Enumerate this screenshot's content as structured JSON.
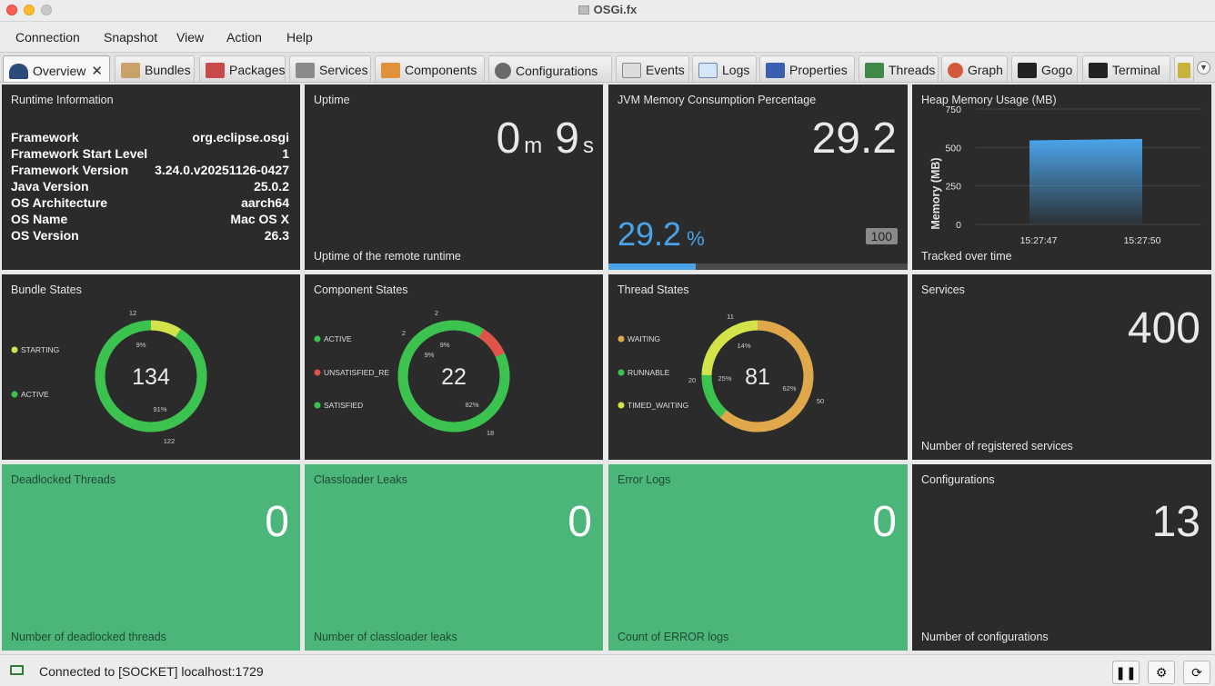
{
  "window": {
    "title": "OSGi.fx"
  },
  "menu": [
    "Connection",
    "Snapshot",
    "View",
    "Action",
    "Help"
  ],
  "tabs": [
    "Overview",
    "Bundles",
    "Packages",
    "Services",
    "Components",
    "Configurations",
    "Events",
    "Logs",
    "Properties",
    "Threads",
    "Graph",
    "Gogo",
    "Terminal"
  ],
  "runtime": {
    "title": "Runtime Information",
    "rows": [
      {
        "k": "Framework",
        "v": "org.eclipse.osgi"
      },
      {
        "k": "Framework Start Level",
        "v": "1"
      },
      {
        "k": "Framework Version",
        "v": "3.24.0.v20251126-0427"
      },
      {
        "k": "Java Version",
        "v": "25.0.2"
      },
      {
        "k": "OS Architecture",
        "v": "aarch64"
      },
      {
        "k": "OS Name",
        "v": "Mac OS X"
      },
      {
        "k": "OS Version",
        "v": "26.3"
      }
    ]
  },
  "uptime": {
    "title": "Uptime",
    "min": "0",
    "min_unit": "m",
    "sec": "9",
    "sec_unit": "s",
    "desc": "Uptime of the remote runtime"
  },
  "jvm": {
    "title": "JVM Memory Consumption Percentage",
    "value": "29.2",
    "pct": "29.2",
    "pct_unit": "%",
    "max": "100",
    "fill": 0.292,
    "accent": "#4aa3e8"
  },
  "heap": {
    "title": "Heap Memory Usage (MB)",
    "desc": "Tracked over time"
  },
  "bundles": {
    "title": "Bundle States",
    "center": "134"
  },
  "components": {
    "title": "Component States",
    "center": "22"
  },
  "threads": {
    "title": "Thread States",
    "center": "81"
  },
  "services": {
    "title": "Services",
    "value": "400",
    "desc": "Number of registered services"
  },
  "deadlocked": {
    "title": "Deadlocked Threads",
    "value": "0",
    "desc": "Number of deadlocked threads"
  },
  "leaks": {
    "title": "Classloader Leaks",
    "value": "0",
    "desc": "Number of classloader leaks"
  },
  "errors": {
    "title": "Error Logs",
    "value": "0",
    "desc": "Count of ERROR logs"
  },
  "configs": {
    "title": "Configurations",
    "value": "13",
    "desc": "Number of configurations"
  },
  "status": {
    "text": "Connected to [SOCKET] localhost:1729"
  },
  "chart_data": [
    {
      "type": "area",
      "title": "Heap Memory Usage (MB)",
      "ylabel": "Memory (MB)",
      "x": [
        "15:27:47",
        "15:27:50"
      ],
      "yticks": [
        0,
        250,
        500,
        750
      ],
      "ylim": [
        0,
        750
      ],
      "series": [
        {
          "values": [
            540,
            550
          ]
        }
      ]
    },
    {
      "type": "pie",
      "title": "Bundle States",
      "center": "134",
      "slices": [
        {
          "label": "STARTING",
          "value": 12,
          "pct": "9%",
          "color": "#d5e34a"
        },
        {
          "label": "ACTIVE",
          "value": 122,
          "pct": "91%",
          "color": "#3cc24e"
        }
      ]
    },
    {
      "type": "pie",
      "title": "Component States",
      "center": "22",
      "slices": [
        {
          "label": "ACTIVE",
          "value": 2,
          "pct": "9%",
          "color": "#3cc24e"
        },
        {
          "label": "UNSATISFIED_RE",
          "value": 2,
          "pct": "9%",
          "color": "#e0524a"
        },
        {
          "label": "SATISFIED",
          "value": 18,
          "pct": "82%",
          "color": "#3cc24e"
        }
      ]
    },
    {
      "type": "pie",
      "title": "Thread States",
      "center": "81",
      "slices": [
        {
          "label": "WAITING",
          "value": 50,
          "pct": "62%",
          "color": "#e0a84a"
        },
        {
          "label": "RUNNABLE",
          "value": 11,
          "pct": "14%",
          "color": "#3cc24e"
        },
        {
          "label": "TIMED_WAITING",
          "value": 20,
          "pct": "25%",
          "color": "#d5e34a"
        }
      ]
    }
  ]
}
